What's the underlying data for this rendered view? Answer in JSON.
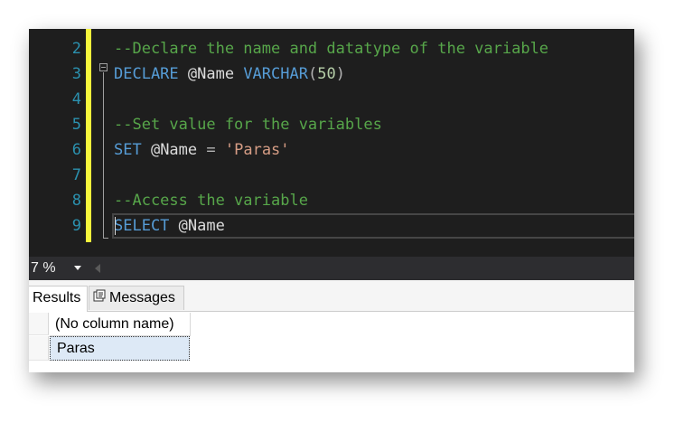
{
  "editor": {
    "lines": [
      {
        "number": "2",
        "tokens": [
          {
            "text": "--Declare the name and datatype of the variable",
            "cls": "cm"
          }
        ]
      },
      {
        "number": "3",
        "tokens": [
          {
            "text": "DECLARE",
            "cls": "kw"
          },
          {
            "text": " @Name ",
            "cls": ""
          },
          {
            "text": "VARCHAR",
            "cls": "kw"
          },
          {
            "text": "(",
            "cls": "op"
          },
          {
            "text": "50",
            "cls": "num"
          },
          {
            "text": ")",
            "cls": "op"
          }
        ]
      },
      {
        "number": "4",
        "tokens": []
      },
      {
        "number": "5",
        "tokens": [
          {
            "text": "--Set value for the variables",
            "cls": "cm"
          }
        ]
      },
      {
        "number": "6",
        "tokens": [
          {
            "text": "SET",
            "cls": "kw"
          },
          {
            "text": " @Name ",
            "cls": ""
          },
          {
            "text": "=",
            "cls": "op"
          },
          {
            "text": " ",
            "cls": ""
          },
          {
            "text": "'Paras'",
            "cls": "st"
          }
        ]
      },
      {
        "number": "7",
        "tokens": []
      },
      {
        "number": "8",
        "tokens": [
          {
            "text": "--Access the variable",
            "cls": "cm"
          }
        ]
      },
      {
        "number": "9",
        "tokens": [
          {
            "text": "SELECT",
            "cls": "kw"
          },
          {
            "text": " @Name",
            "cls": ""
          }
        ]
      }
    ]
  },
  "statusbar": {
    "zoom": "7 %"
  },
  "results": {
    "tabs": {
      "results_label": "Results",
      "messages_label": "Messages"
    },
    "column_header": "(No column name)",
    "rows": [
      {
        "value": "Paras"
      }
    ]
  },
  "colors": {
    "editor_bg": "#1e1e1e",
    "keyword": "#569cd6",
    "comment": "#57a64a",
    "string": "#d69d85",
    "line_number": "#2b91af",
    "change_marker": "#f7f73c",
    "selected_cell": "#dde9f6"
  }
}
